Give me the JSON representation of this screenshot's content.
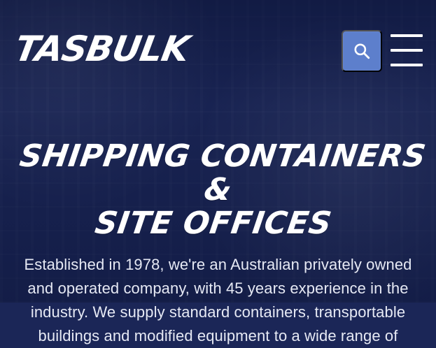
{
  "header": {
    "logo_text": "TASBULK",
    "search_icon": "search-icon",
    "menu_icon": "hamburger-menu-icon"
  },
  "hero": {
    "title_line1": "SHIPPING CONTAINERS &",
    "title_line2": "SITE OFFICES",
    "description": "Established in 1978, we're an Australian privately owned and operated company, with 45 years experience in the industry. We supply standard containers, transportable buildings and modified equipment to a wide range of"
  },
  "colors": {
    "background": "#1b2657",
    "search_button": "#5d7fcc",
    "text": "#ffffff"
  }
}
